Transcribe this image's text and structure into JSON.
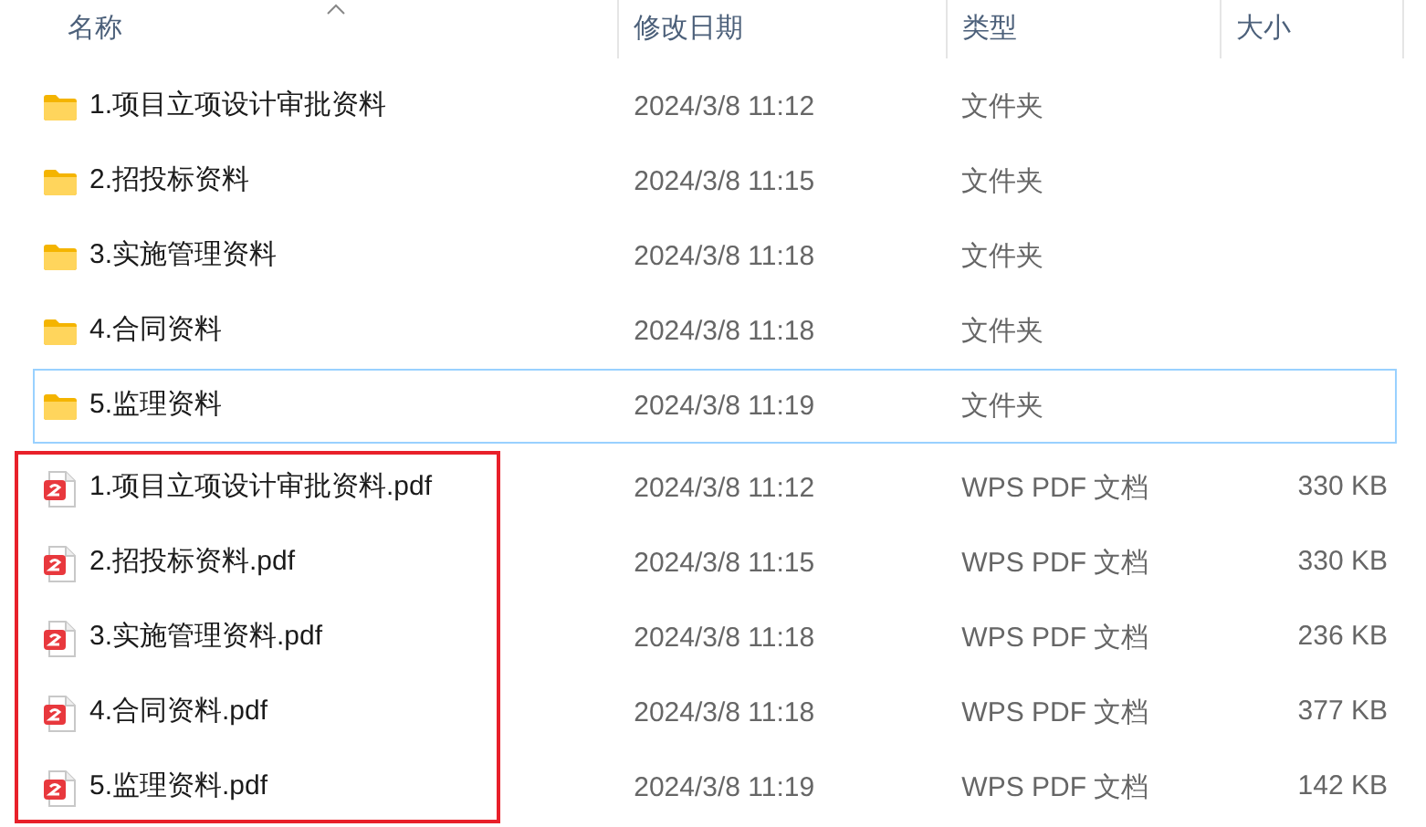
{
  "columns": [
    {
      "label": "名称",
      "sorted": true
    },
    {
      "label": "修改日期",
      "sorted": false
    },
    {
      "label": "类型",
      "sorted": false
    },
    {
      "label": "大小",
      "sorted": false
    }
  ],
  "folders": [
    {
      "kind": "folder",
      "name": "1.项目立项设计审批资料",
      "modified": "2024/3/8 11:12",
      "type": "文件夹",
      "focused": false
    },
    {
      "kind": "folder",
      "name": "2.招投标资料",
      "modified": "2024/3/8 11:15",
      "type": "文件夹",
      "focused": false
    },
    {
      "kind": "folder",
      "name": "3.实施管理资料",
      "modified": "2024/3/8 11:18",
      "type": "文件夹",
      "focused": false
    },
    {
      "kind": "folder",
      "name": "4.合同资料",
      "modified": "2024/3/8 11:18",
      "type": "文件夹",
      "focused": false
    },
    {
      "kind": "folder",
      "name": "5.监理资料",
      "modified": "2024/3/8 11:19",
      "type": "文件夹",
      "focused": true
    }
  ],
  "files": {
    "highlighted": true,
    "items": [
      {
        "kind": "pdf",
        "name": "1.项目立项设计审批资料.pdf",
        "modified": "2024/3/8 11:12",
        "type": "WPS PDF 文档",
        "size": "330 KB",
        "focused": false
      },
      {
        "kind": "pdf",
        "name": "2.招投标资料.pdf",
        "modified": "2024/3/8 11:15",
        "type": "WPS PDF 文档",
        "size": "330 KB",
        "focused": false
      },
      {
        "kind": "pdf",
        "name": "3.实施管理资料.pdf",
        "modified": "2024/3/8 11:18",
        "type": "WPS PDF 文档",
        "size": "236 KB",
        "focused": false
      },
      {
        "kind": "pdf",
        "name": "4.合同资料.pdf",
        "modified": "2024/3/8 11:18",
        "type": "WPS PDF 文档",
        "size": "377 KB",
        "focused": false
      },
      {
        "kind": "pdf",
        "name": "5.监理资料.pdf",
        "modified": "2024/3/8 11:19",
        "type": "WPS PDF 文档",
        "size": "142 KB",
        "focused": false
      }
    ]
  }
}
